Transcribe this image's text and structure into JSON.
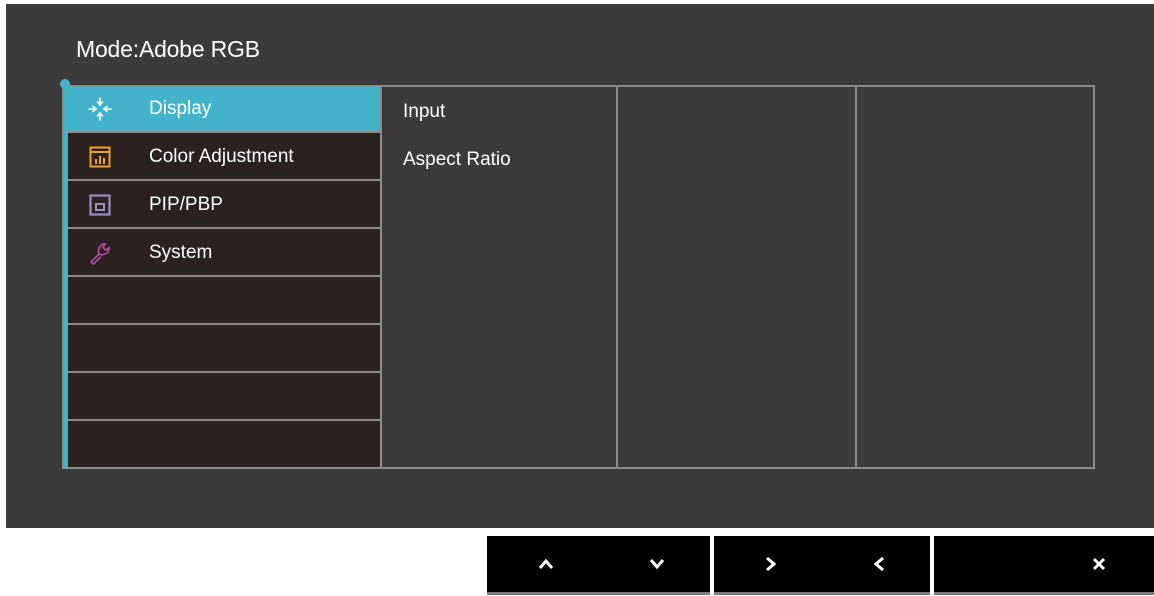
{
  "osd": {
    "mode_label": "Mode:",
    "mode_value": "Adobe RGB"
  },
  "menu": {
    "items": [
      {
        "label": "Display",
        "icon": "display-arrows-icon",
        "active": true
      },
      {
        "label": "Color Adjustment",
        "icon": "color-adjustment-icon",
        "active": false
      },
      {
        "label": "PIP/PBP",
        "icon": "pip-pbp-icon",
        "active": false
      },
      {
        "label": "System",
        "icon": "wrench-icon",
        "active": false
      }
    ]
  },
  "submenu": {
    "items": [
      {
        "label": "Input"
      },
      {
        "label": "Aspect Ratio"
      }
    ]
  },
  "buttons": [
    {
      "icon": "chevron-up-icon"
    },
    {
      "icon": "chevron-down-icon"
    },
    {
      "icon": "chevron-right-icon"
    },
    {
      "icon": "chevron-left-icon"
    },
    {
      "icon": "close-icon"
    }
  ],
  "colors": {
    "accent": "#42b3cb",
    "osd_background": "#3c3b3a",
    "menu_background": "#2a2120",
    "color_adjustment_icon": "#f0a020",
    "pip_icon": "#9a8ec0",
    "system_icon": "#c24ba8"
  }
}
